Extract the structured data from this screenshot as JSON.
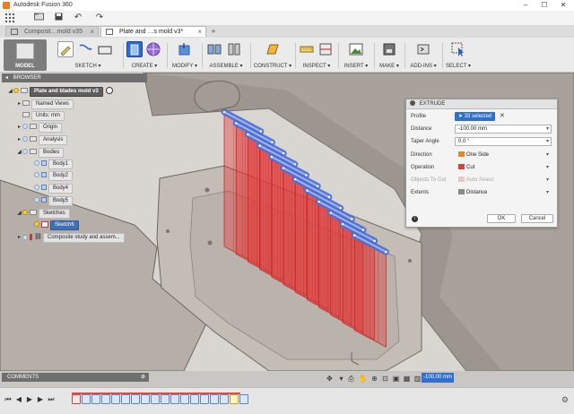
{
  "app": {
    "title": "Autodesk Fusion 360"
  },
  "window_buttons": [
    "–",
    "☐",
    "✕"
  ],
  "quick_access": {
    "icons": [
      "grid-icon",
      "file-icon",
      "save-icon",
      "undo-icon",
      "redo-icon"
    ]
  },
  "tabs": [
    {
      "label": "Composit…mold v35",
      "active": false
    },
    {
      "label": "Plate and …s mold v3*",
      "active": true
    }
  ],
  "toolbar": {
    "workspace": "MODEL",
    "groups": [
      {
        "label": "SKETCH ▾"
      },
      {
        "label": "CREATE ▾"
      },
      {
        "label": "MODIFY ▾"
      },
      {
        "label": "ASSEMBLE ▾"
      },
      {
        "label": "CONSTRUCT ▾"
      },
      {
        "label": "INSPECT ▾"
      },
      {
        "label": "INSERT ▾"
      },
      {
        "label": "MAKE ▾"
      },
      {
        "label": "ADD-INS ▾"
      },
      {
        "label": "SELECT ▾"
      }
    ]
  },
  "browser": {
    "header": "BROWSER",
    "root": "Plate and blades mold v3",
    "items": {
      "named_views": "Named Views",
      "units": "Units: mm",
      "origin": "Origin",
      "analysis": "Analysis",
      "bodies": "Bodies",
      "body1": "Body1",
      "body2": "Body2",
      "body4": "Body4",
      "body5": "Body5",
      "sketches": "Sketches",
      "sketch6": "Sketch6",
      "composite": "Composite study and assem..."
    }
  },
  "extrude": {
    "title": "EXTRUDE",
    "profile_label": "Profile",
    "profile_value": "33 selected",
    "distance_label": "Distance",
    "distance_value": "-100.00 mm",
    "taper_label": "Taper Angle",
    "taper_value": "0.0 °",
    "direction_label": "Direction",
    "direction_value": "One Side",
    "operation_label": "Operation",
    "operation_value": "Cut",
    "objects_label": "Objects To Cut",
    "objects_value": "Auto Select",
    "extents_label": "Extents",
    "extents_value": "Distance",
    "ok": "OK",
    "cancel": "Cancel"
  },
  "viewport": {
    "zoom_value": "-100.00 mm"
  },
  "comments": {
    "header": "COMMENTS"
  },
  "colors": {
    "accent": "#2f6fd0",
    "cut_preview": "#e23b3b",
    "slot_profile": "#4d6fd6",
    "model_surface": "#a9a09a"
  }
}
